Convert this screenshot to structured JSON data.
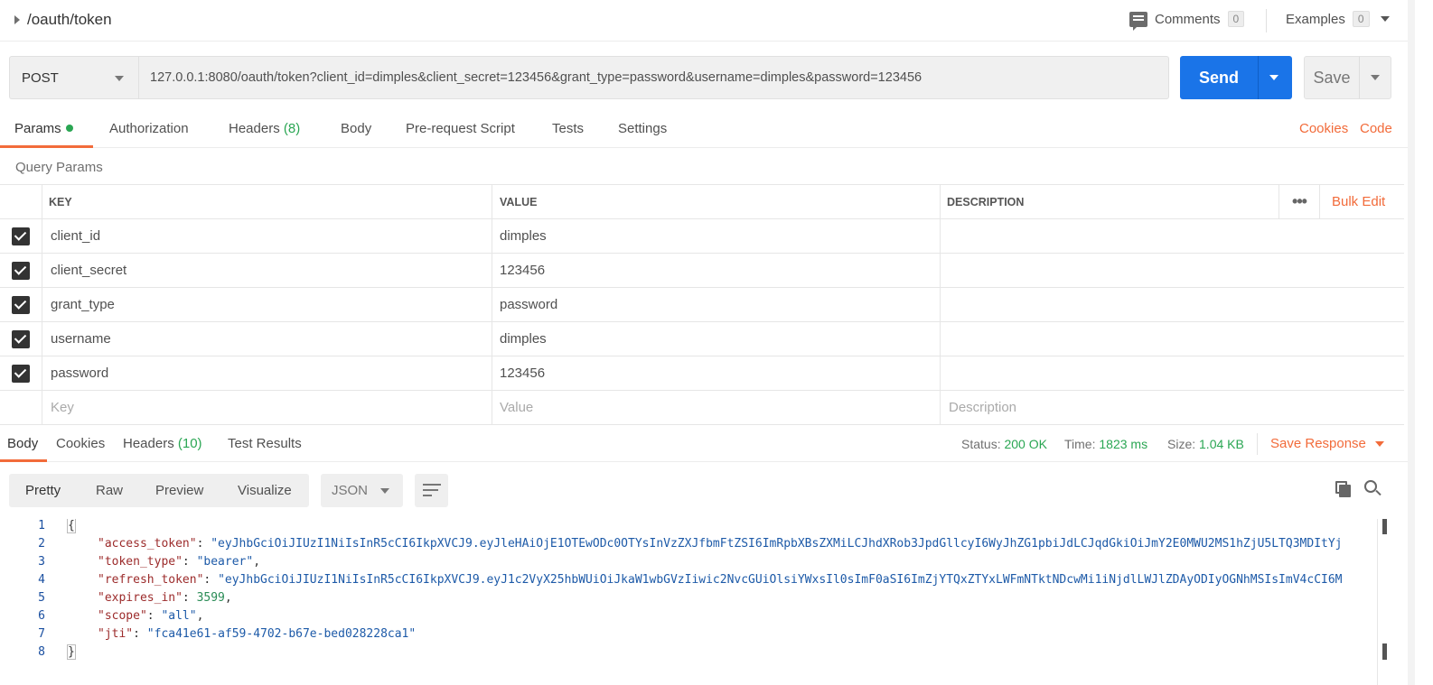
{
  "header": {
    "title": "/oauth/token",
    "comments_label": "Comments",
    "comments_count": "0",
    "examples_label": "Examples",
    "examples_count": "0"
  },
  "request": {
    "method": "POST",
    "url": "127.0.0.1:8080/oauth/token?client_id=dimples&client_secret=123456&grant_type=password&username=dimples&password=123456",
    "send_label": "Send",
    "save_label": "Save"
  },
  "request_tabs": {
    "params": "Params",
    "authorization": "Authorization",
    "headers": "Headers",
    "headers_count": "(8)",
    "body": "Body",
    "prerequest": "Pre-request Script",
    "tests": "Tests",
    "settings": "Settings",
    "cookies": "Cookies",
    "code": "Code"
  },
  "query_params": {
    "section_label": "Query Params",
    "columns": {
      "key": "KEY",
      "value": "VALUE",
      "description": "DESCRIPTION"
    },
    "more_label": "•••",
    "bulk_edit": "Bulk Edit",
    "rows": [
      {
        "key": "client_id",
        "value": "dimples",
        "description": ""
      },
      {
        "key": "client_secret",
        "value": "123456",
        "description": ""
      },
      {
        "key": "grant_type",
        "value": "password",
        "description": ""
      },
      {
        "key": "username",
        "value": "dimples",
        "description": ""
      },
      {
        "key": "password",
        "value": "123456",
        "description": ""
      }
    ],
    "placeholders": {
      "key": "Key",
      "value": "Value",
      "description": "Description"
    }
  },
  "response_tabs": {
    "body": "Body",
    "cookies": "Cookies",
    "headers": "Headers",
    "headers_count": "(10)",
    "test_results": "Test Results"
  },
  "response_meta": {
    "status_label": "Status:",
    "status_value": "200 OK",
    "time_label": "Time:",
    "time_value": "1823 ms",
    "size_label": "Size:",
    "size_value": "1.04 KB",
    "save_response": "Save Response"
  },
  "response_view": {
    "pretty": "Pretty",
    "raw": "Raw",
    "preview": "Preview",
    "visualize": "Visualize",
    "format": "JSON"
  },
  "response_body": {
    "line_numbers": [
      "1",
      "2",
      "3",
      "4",
      "5",
      "6",
      "7",
      "8"
    ],
    "open_brace": "{",
    "close_brace": "}",
    "access_token_key": "\"access_token\"",
    "access_token_value": "\"eyJhbGciOiJIUzI1NiIsInR5cCI6IkpXVCJ9.eyJleHAiOjE1OTEwODc0OTYsInVzZXJfbmFtZSI6ImRpbXBsZXMiLCJhdXRob3JpdGllcyI6WyJhZG1pbiJdLCJqdGkiOiJmY2E0MWU2MS1hZjU5LTQ3MDItYj",
    "token_type_key": "\"token_type\"",
    "token_type_value": "\"bearer\"",
    "refresh_token_key": "\"refresh_token\"",
    "refresh_token_value": "\"eyJhbGciOiJIUzI1NiIsInR5cCI6IkpXVCJ9.eyJ1c2VyX25hbWUiOiJkaW1wbGVzIiwic2NvcGUiOlsiYWxsIl0sImF0aSI6ImZjYTQxZTYxLWFmNTktNDcwMi1iNjdlLWJlZDAyODIyOGNhMSIsImV4cCI6M",
    "expires_in_key": "\"expires_in\"",
    "expires_in_value": "3599",
    "scope_key": "\"scope\"",
    "scope_value": "\"all\"",
    "jti_key": "\"jti\"",
    "jti_value": "\"fca41e61-af59-4702-b67e-bed028228ca1\""
  },
  "colors": {
    "accent_orange": "#f26b3a",
    "send_blue": "#1a74e8",
    "status_green": "#2aa653"
  },
  "icons": [
    "caret-right-icon",
    "comment-icon",
    "chevron-down-icon",
    "checkbox-checked-icon",
    "more-dots-icon",
    "wrap-lines-icon",
    "copy-icon",
    "search-icon"
  ]
}
